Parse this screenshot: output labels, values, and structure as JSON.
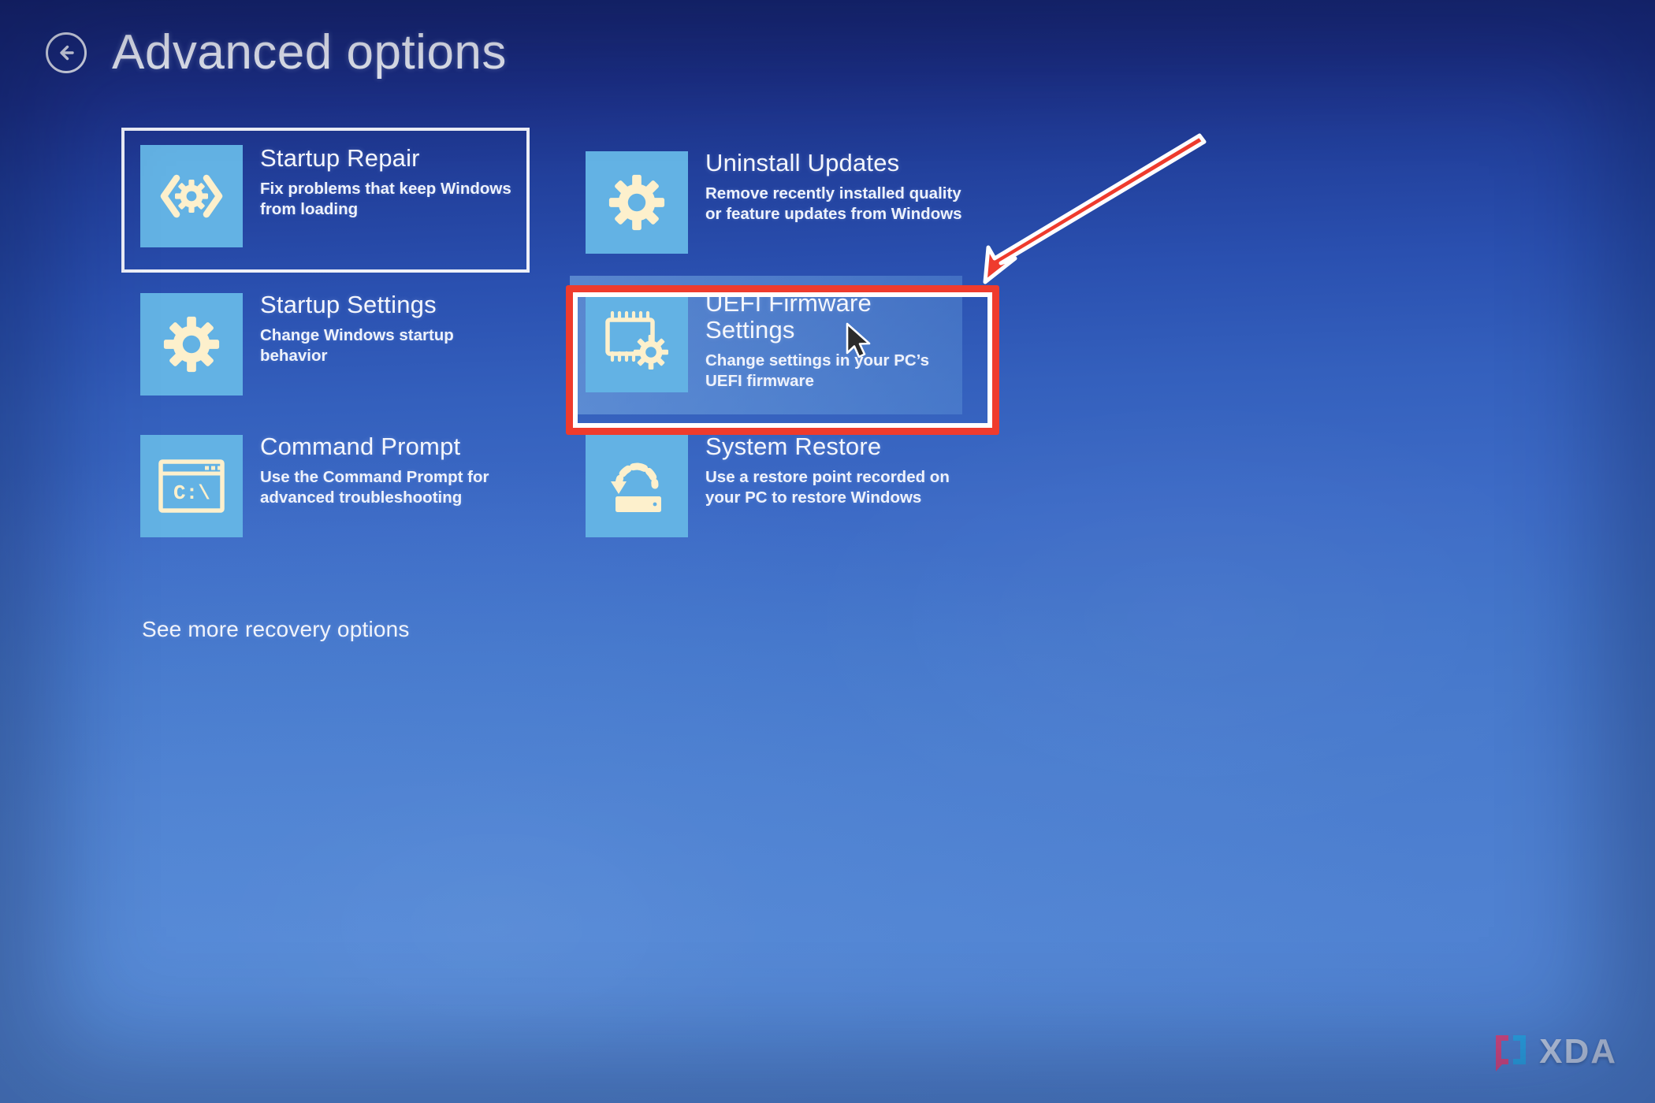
{
  "header": {
    "back_icon": "back-arrow-circle-icon",
    "title": "Advanced options"
  },
  "tiles": [
    {
      "id": "startup-repair",
      "icon": "code-brackets-gear-icon",
      "title": "Startup Repair",
      "desc": "Fix problems that keep Windows from loading",
      "state": "focused"
    },
    {
      "id": "uninstall-updates",
      "icon": "gear-icon",
      "title": "Uninstall Updates",
      "desc": "Remove recently installed quality or feature updates from Windows",
      "state": "normal"
    },
    {
      "id": "startup-settings",
      "icon": "gear-icon",
      "title": "Startup Settings",
      "desc": "Change Windows startup behavior",
      "state": "normal"
    },
    {
      "id": "uefi-firmware-settings",
      "icon": "chip-gear-icon",
      "title": "UEFI Firmware Settings",
      "desc": "Change settings in your PC’s UEFI firmware",
      "state": "hovered"
    },
    {
      "id": "command-prompt",
      "icon": "console-window-icon",
      "title": "Command Prompt",
      "desc": "Use the Command Prompt for advanced troubleshooting",
      "state": "normal"
    },
    {
      "id": "system-restore",
      "icon": "disk-restore-arrow-icon",
      "title": "System Restore",
      "desc": "Use a restore point recorded on your PC to restore Windows",
      "state": "normal"
    }
  ],
  "see_more_label": "See more recovery options",
  "annotations": {
    "highlight_target": "uefi-firmware-settings",
    "box_color": "#ef3b2d",
    "box_inner_color": "#ffffff",
    "arrow_color": "#ef3b2d",
    "arrow_outline_color": "#ffffff",
    "cursor": "mouse-pointer"
  },
  "watermark": {
    "text": "XDA",
    "mark_colors": [
      "#e0457b",
      "#2aa8e8"
    ]
  },
  "colors": {
    "tile_icon_bg": "#63b2e4",
    "icon_glyph": "#fdf0cc",
    "text": "#f2f4fb",
    "bg_top": "#17246e",
    "bg_bottom": "#5286d4"
  }
}
